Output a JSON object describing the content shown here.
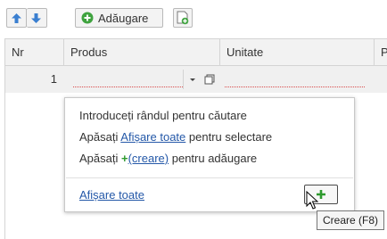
{
  "toolbar": {
    "move_up_icon": "arrow-up-icon",
    "move_down_icon": "arrow-down-icon",
    "add_label": "Adăugare",
    "copy_icon": "copy-add-icon"
  },
  "table": {
    "columns": [
      "Nr",
      "Produs",
      "Unitate",
      "P"
    ],
    "rows": [
      {
        "nr": "1",
        "produs": "",
        "unitate": ""
      }
    ]
  },
  "popup": {
    "line1": "Introduceți rândul pentru căutare",
    "line2_prefix": "Apăsați",
    "line2_link": "Afișare toate",
    "line2_suffix": "pentru selectare",
    "line3_prefix": "Apăsați",
    "line3_plus": "+",
    "line3_link": "(creare)",
    "line3_suffix": "pentru adăugare",
    "show_all_link": "Afișare toate",
    "create_button_icon": "plus-icon"
  },
  "tooltip": "Creare (F8)",
  "colors": {
    "accent_blue": "#3a7fd0",
    "accent_green": "#2e9a2e",
    "link": "#2458a8"
  }
}
